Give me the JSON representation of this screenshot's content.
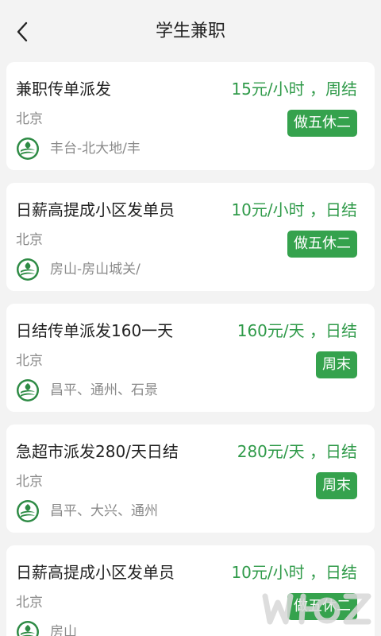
{
  "header": {
    "title": "学生兼职",
    "back_icon": "chevron-left-icon"
  },
  "colors": {
    "accent": "#35a24d",
    "salary": "#2f9a49",
    "background": "#f3f3f3",
    "card": "#ffffff",
    "muted_text": "#8a8a8a"
  },
  "jobs": [
    {
      "title": "兼职传单派发",
      "salary": "15元/小时 ，周结",
      "city": "北京",
      "tag": "做五休二",
      "address": "丰台-北大地/丰"
    },
    {
      "title": "日薪高提成小区发单员",
      "salary": "10元/小时 ，日结",
      "city": "北京",
      "tag": "做五休二",
      "address": "房山-房山城关/"
    },
    {
      "title": "日结传单派发160一天",
      "salary": "160元/天 ，日结",
      "city": "北京",
      "tag": "周末",
      "address": "昌平、通州、石景"
    },
    {
      "title": "急超市派发280/天日结",
      "salary": "280元/天 ，日结",
      "city": "北京",
      "tag": "周末",
      "address": "昌平、大兴、通州"
    },
    {
      "title": "日薪高提成小区发单员",
      "salary": "10元/小时 ，日结",
      "city": "北京",
      "tag": "做五休二",
      "address": "房山"
    }
  ]
}
